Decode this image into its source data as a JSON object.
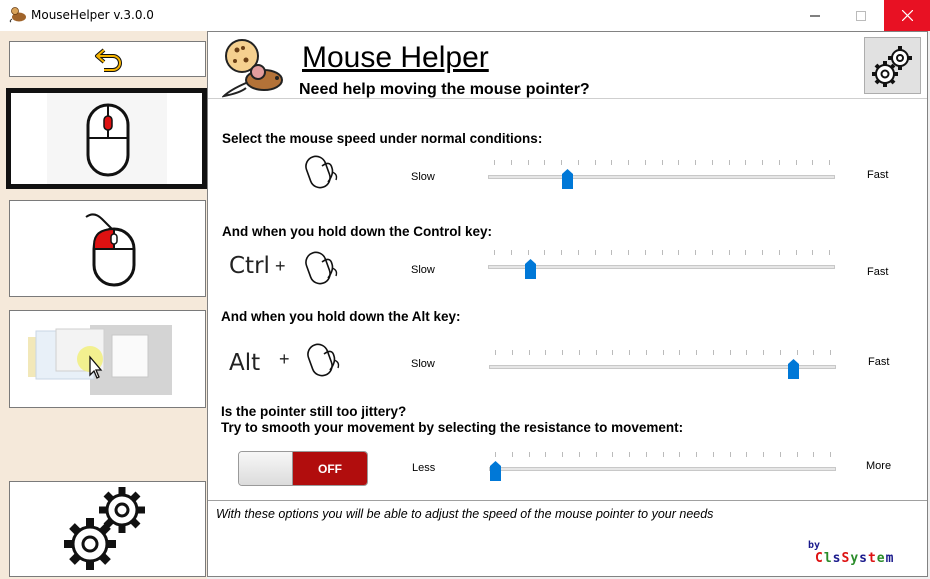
{
  "window": {
    "title": "MouseHelper v.3.0.0"
  },
  "header": {
    "title": "Mouse Helper",
    "subtitle": "Need help moving the mouse pointer?"
  },
  "sections": {
    "normal": {
      "label": "Select the mouse speed under normal conditions:",
      "min_label": "Slow",
      "max_label": "Fast",
      "value": 0.22
    },
    "ctrl": {
      "label": "And when you hold down the Control key:",
      "key": "Ctrl",
      "plus": "+",
      "min_label": "Slow",
      "max_label": "Fast",
      "value": 0.11
    },
    "alt": {
      "label": "And when you hold down the Alt key:",
      "key": "Alt",
      "plus": "+",
      "min_label": "Slow",
      "max_label": "Fast",
      "value": 0.89
    },
    "smooth": {
      "label1": "Is the pointer still too jittery?",
      "label2": "Try to smooth your movement by selecting the resistance to movement:",
      "toggle": "OFF",
      "min_label": "Less",
      "max_label": "More",
      "value": 0.0
    }
  },
  "footer": {
    "text": "With these options you will be able to adjust the speed of the mouse pointer to your needs",
    "by": "by",
    "brand": "ClsSystem"
  },
  "icons": [
    "mouse-helper-app-icon",
    "minimize-icon",
    "maximize-icon",
    "close-icon",
    "back-arrow-icon",
    "mouse-speed-icon",
    "mouse-click-icon",
    "smoothing-icon",
    "settings-gears-icon",
    "mouse-cookie-logo",
    "hand-mouse-icon"
  ],
  "colors": {
    "accent": "#0078d7",
    "close": "#e81123",
    "toggle_off": "#b10d0d",
    "sidebar": "#f5e9da"
  }
}
